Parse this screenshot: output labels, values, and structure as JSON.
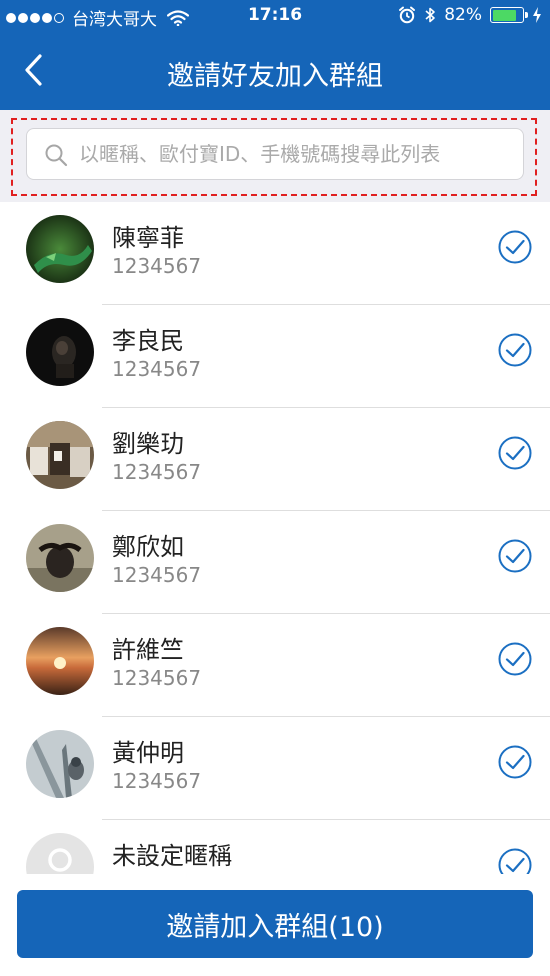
{
  "status_bar": {
    "carrier": "台湾大哥大",
    "time": "17:16",
    "battery_percent": "82%",
    "battery_level": 0.82,
    "signal_bars_filled": 4,
    "signal_bars_total": 5
  },
  "nav": {
    "title": "邀請好友加入群組",
    "back_icon": "chevron-left-icon"
  },
  "search": {
    "placeholder": "以暱稱、歐付寶ID、手機號碼搜尋此列表",
    "value": "",
    "icon": "search-icon"
  },
  "contacts": [
    {
      "name": "陳寧菲",
      "id": "1234567",
      "selected": true,
      "avatar": "lizard-photo"
    },
    {
      "name": "李良民",
      "id": "1234567",
      "selected": true,
      "avatar": "monkey-photo"
    },
    {
      "name": "劉樂玏",
      "id": "1234567",
      "selected": true,
      "avatar": "cows-photo"
    },
    {
      "name": "鄭欣如",
      "id": "1234567",
      "selected": true,
      "avatar": "buffalo-photo"
    },
    {
      "name": "許維竺",
      "id": "1234567",
      "selected": true,
      "avatar": "sunset-photo"
    },
    {
      "name": "黃仲明",
      "id": "1234567",
      "selected": true,
      "avatar": "bird-photo"
    },
    {
      "name": "未設定暱稱",
      "id": "",
      "selected": true,
      "avatar": "default-user-icon"
    }
  ],
  "invite_button": {
    "label": "邀請加入群組(10)"
  },
  "colors": {
    "brand_blue": "#1565b8",
    "check_blue": "#1b6fc2",
    "highlight_dash": "#e02020"
  }
}
